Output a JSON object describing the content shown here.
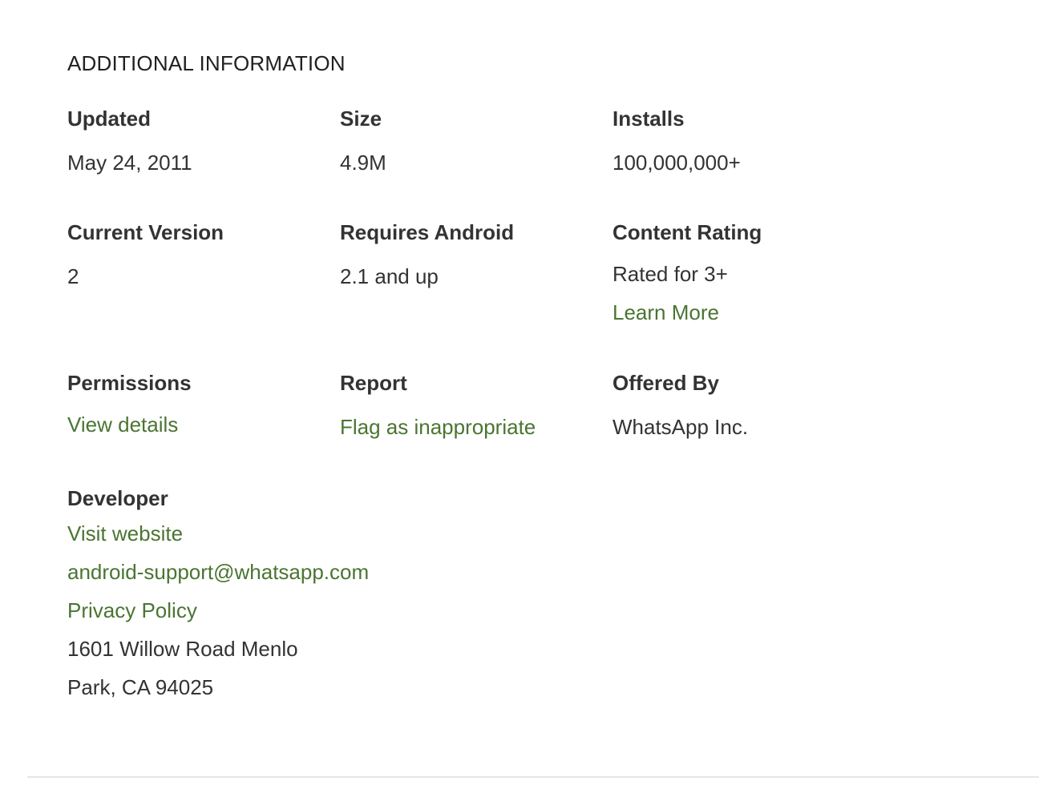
{
  "section": {
    "title": "ADDITIONAL INFORMATION"
  },
  "updated": {
    "label": "Updated",
    "value": "May 24, 2011"
  },
  "size": {
    "label": "Size",
    "value": "4.9M"
  },
  "installs": {
    "label": "Installs",
    "value": "100,000,000+"
  },
  "current_version": {
    "label": "Current Version",
    "value": "2"
  },
  "requires_android": {
    "label": "Requires Android",
    "value": "2.1 and up"
  },
  "content_rating": {
    "label": "Content Rating",
    "value": "Rated for 3+",
    "link": "Learn More"
  },
  "permissions": {
    "label": "Permissions",
    "link": "View details"
  },
  "report": {
    "label": "Report",
    "link": "Flag as inappropriate"
  },
  "offered_by": {
    "label": "Offered By",
    "value": "WhatsApp Inc."
  },
  "developer": {
    "label": "Developer",
    "website_link": "Visit website",
    "email_link": "android-support@whatsapp.com",
    "privacy_link": "Privacy Policy",
    "address_line1": "1601 Willow Road Menlo",
    "address_line2": "Park, CA 94025"
  },
  "colors": {
    "link": "#4a7532",
    "text": "#333333",
    "divider": "#e6e6e6"
  }
}
